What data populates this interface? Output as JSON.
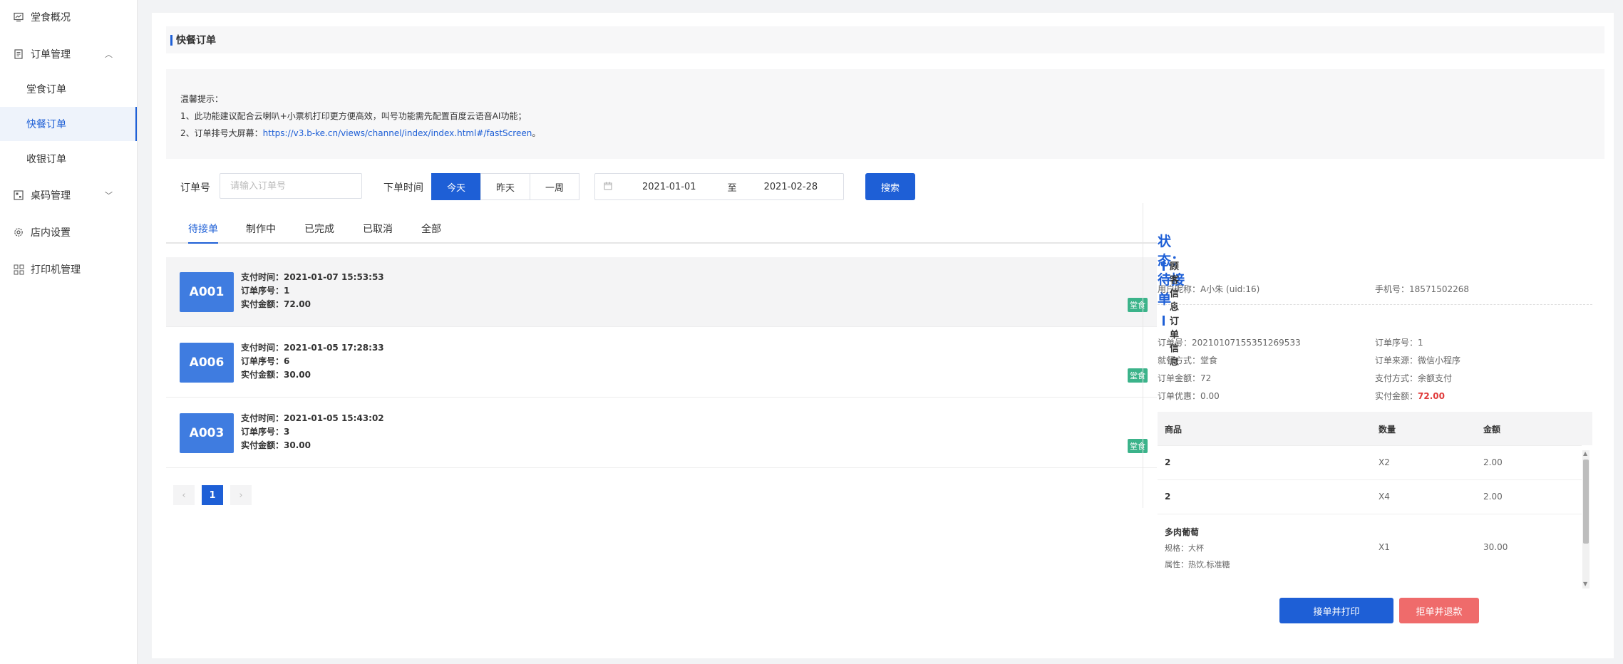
{
  "sidebar": {
    "items": [
      {
        "label": "堂食概况",
        "icon": "dashboard-icon"
      },
      {
        "label": "订单管理",
        "icon": "document-icon"
      },
      {
        "label": "桌码管理",
        "icon": "qrcode-icon"
      },
      {
        "label": "店内设置",
        "icon": "gear-icon"
      },
      {
        "label": "打印机管理",
        "icon": "grid-icon"
      }
    ],
    "sub_items": [
      "堂食订单",
      "快餐订单",
      "收银订单"
    ],
    "active_sub": "快餐订单"
  },
  "page": {
    "title": "快餐订单",
    "notice_title": "温馨提示：",
    "notice_line1": "1、此功能建议配合云喇叭+小票机打印更方便高效，叫号功能需先配置百度云语音AI功能；",
    "notice_line2_prefix": "2、订单排号大屏幕：",
    "notice_link": "https://v3.b-ke.cn/views/channel/index/index.html#/fastScreen",
    "notice_line2_suffix": "。"
  },
  "filters": {
    "order_no_label": "订单号",
    "order_no_placeholder": "请输入订单号",
    "order_time_label": "下单时间",
    "time_options": [
      "今天",
      "昨天",
      "一周"
    ],
    "time_selected": "今天",
    "date_start": "2021-01-01",
    "date_sep": "至",
    "date_end": "2021-02-28",
    "search_label": "搜索"
  },
  "tabs": {
    "labels": [
      "待接单",
      "制作中",
      "已完成",
      "已取消",
      "全部"
    ],
    "active": "待接单"
  },
  "orders": [
    {
      "code": "A001",
      "pay_time_label": "支付时间：",
      "pay_time": "2021-01-07 15:53:53",
      "seq_label": "订单序号：",
      "seq": "1",
      "amount_label": "实付金额：",
      "amount": "72.00",
      "tag": "堂食"
    },
    {
      "code": "A006",
      "pay_time_label": "支付时间：",
      "pay_time": "2021-01-05 17:28:33",
      "seq_label": "订单序号：",
      "seq": "6",
      "amount_label": "实付金额：",
      "amount": "30.00",
      "tag": "堂食"
    },
    {
      "code": "A003",
      "pay_time_label": "支付时间：",
      "pay_time": "2021-01-05 15:43:02",
      "seq_label": "订单序号：",
      "seq": "3",
      "amount_label": "实付金额：",
      "amount": "30.00",
      "tag": "堂食"
    }
  ],
  "pagination": {
    "prev": "‹",
    "current": "1",
    "next": "›"
  },
  "detail": {
    "status_label": "状态：",
    "status": "待接单",
    "customer_section": "顾客信息",
    "nickname_label": "用户昵称：",
    "nickname": "A小朱 (uid:16)",
    "phone_label": "手机号：",
    "phone": "18571502268",
    "order_section": "订单信息",
    "order_no_label": "订单号：",
    "order_no": "20210107155351269533",
    "order_seq_label": "订单序号：",
    "order_seq": "1",
    "dine_label": "就餐方式：",
    "dine": "堂食",
    "source_label": "订单来源：",
    "source": "微信小程序",
    "total_label": "订单金额：",
    "total": "72",
    "pay_method_label": "支付方式：",
    "pay_method": "余额支付",
    "discount_label": "订单优惠：",
    "discount": "0.00",
    "paid_label": "实付金额：",
    "paid": "72.00",
    "goods_headers": [
      "商品",
      "数量",
      "金额"
    ],
    "goods": [
      {
        "name": "2",
        "qty": "X2",
        "price": "2.00"
      },
      {
        "name": "2",
        "qty": "X4",
        "price": "2.00"
      },
      {
        "name": "多肉葡萄",
        "spec": "规格：大杯",
        "attr": "属性：热饮,标准糖",
        "qty": "X1",
        "price": "30.00"
      }
    ],
    "accept_label": "接单并打印",
    "reject_label": "拒单并退款"
  },
  "colors": {
    "primary": "#1e5fd6",
    "danger": "#ef6b6b",
    "tag": "#3bb38a",
    "badge": "#3f7ce0",
    "paid_red": "#e03b3b"
  }
}
